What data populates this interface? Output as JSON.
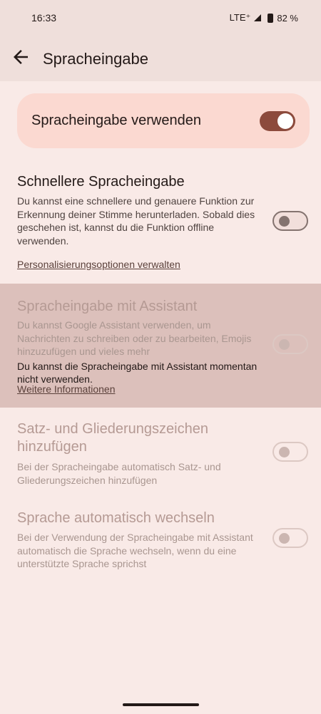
{
  "status": {
    "time": "16:33",
    "network": "LTE⁺",
    "battery": "82 %"
  },
  "app_bar": {
    "title": "Spracheingabe"
  },
  "main_toggle": {
    "label": "Spracheingabe verwenden",
    "on": true
  },
  "faster_input": {
    "title": "Schnellere Spracheingabe",
    "description": "Du kannst eine schnellere und genauere Funktion zur Erkennung deiner Stimme herunterladen. Sobald dies geschehen ist, kannst du die Funktion offline verwenden.",
    "on": false,
    "link": "Personalisierungsoptionen verwalten"
  },
  "assistant": {
    "title": "Spracheingabe mit Assistant",
    "description": "Du kannst Google Assistant verwenden, um Nachrichten zu schreiben oder zu bearbeiten, Emojis hinzuzufügen und vieles mehr",
    "notice": "Du kannst die Spracheingabe mit Assistant momentan nicht verwenden.",
    "link": "Weitere Informationen",
    "on": false
  },
  "punctuation": {
    "title": "Satz- und Gliederungszeichen hinzufügen",
    "description": "Bei der Spracheingabe automatisch Satz- und Gliederungszeichen hinzufügen",
    "on": false
  },
  "auto_language": {
    "title": "Sprache automatisch wechseln",
    "description": "Bei der Verwendung der Spracheingabe mit Assistant automatisch die Sprache wechseln, wenn du eine unterstützte Sprache sprichst",
    "on": false
  }
}
